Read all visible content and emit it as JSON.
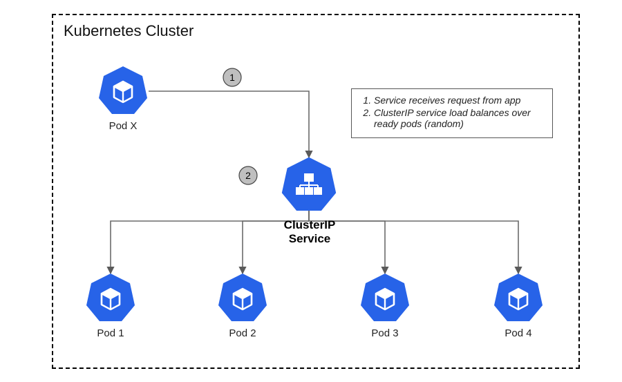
{
  "title": "Kubernetes Cluster",
  "nodes": {
    "podx": {
      "label": "Pod X"
    },
    "svc": {
      "label": "ClusterIP\nService"
    },
    "pod1": {
      "label": "Pod 1"
    },
    "pod2": {
      "label": "Pod 2"
    },
    "pod3": {
      "label": "Pod 3"
    },
    "pod4": {
      "label": "Pod 4"
    }
  },
  "steps": {
    "s1": "1",
    "s2": "2"
  },
  "legend": {
    "item1": "Service receives request from app",
    "item2": "ClusterIP service load balances over ready pods (random)"
  }
}
